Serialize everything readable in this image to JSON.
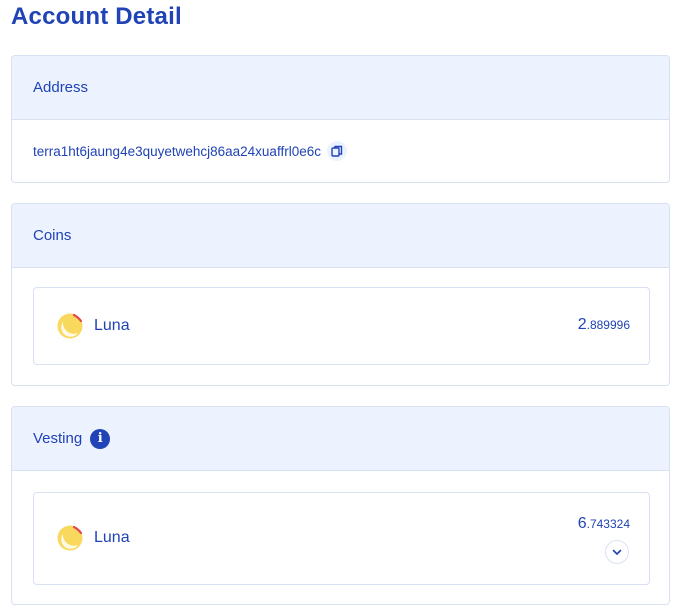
{
  "page": {
    "title": "Account Detail"
  },
  "address": {
    "header": "Address",
    "value": "terra1ht6jaung4e3quyetwehcj86aa24xuaffrl0e6c",
    "copy_icon": "copy-icon"
  },
  "coins": {
    "header": "Coins",
    "items": [
      {
        "name": "Luna",
        "amount_int": "2",
        "amount_dec": ".889996",
        "icon": "luna-logo"
      }
    ]
  },
  "vesting": {
    "header": "Vesting",
    "info_icon": "info-icon",
    "info_glyph": "i",
    "items": [
      {
        "name": "Luna",
        "amount_int": "6",
        "amount_dec": ".743324",
        "icon": "luna-logo",
        "expand_icon": "chevron-down-icon"
      }
    ]
  },
  "colors": {
    "primary": "#2043b5",
    "header_bg": "#ecf3ff",
    "border": "#d9e0f2",
    "luna_yellow": "#f9d85e",
    "luna_red": "#e2484f"
  }
}
